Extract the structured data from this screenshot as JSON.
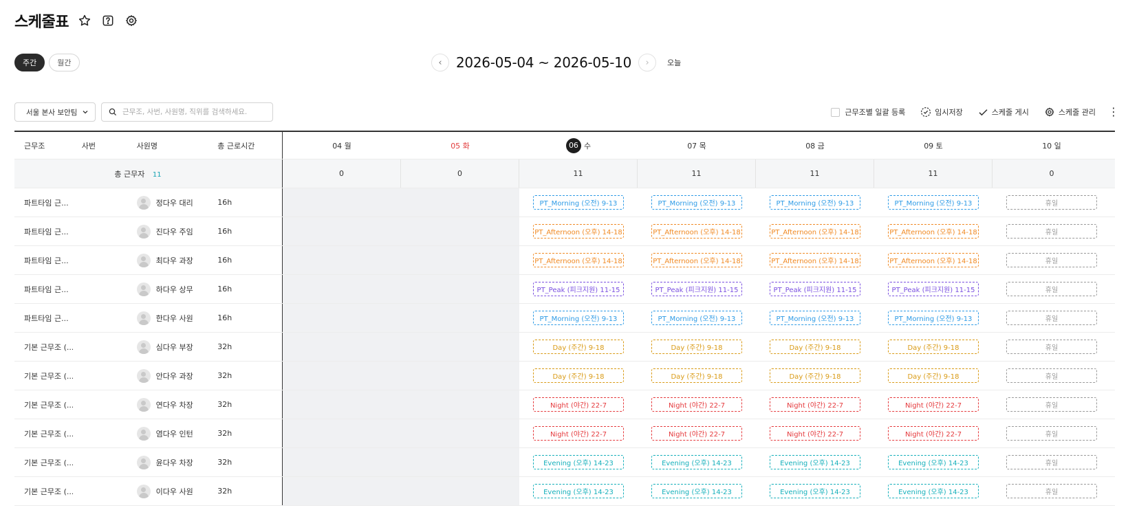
{
  "header": {
    "title": "스케줄표",
    "icons": [
      "star-icon",
      "help-icon",
      "gear-icon"
    ]
  },
  "view_toggle": {
    "weekly": "주간",
    "monthly": "월간",
    "active": "weekly"
  },
  "date_nav": {
    "prev": "‹",
    "range": "2026-05-04 ~ 2026-05-10",
    "next": "›",
    "today": "오늘"
  },
  "toolbar": {
    "team_select": "서울 본사 보안팀",
    "search_placeholder": "근무조, 사번, 사원명, 직위를 검색하세요.",
    "bulk_register": "근무조별 일괄 등록",
    "temp_save": "임시저장",
    "publish": "스케줄 게시",
    "manage": "스케줄 관리"
  },
  "columns": {
    "group": "근무조",
    "emp_no": "사번",
    "name": "사원명",
    "total_hours": "총 근로시간"
  },
  "days": [
    {
      "label": "04 월",
      "num": "",
      "suffix": "",
      "style": "normal",
      "count": "0",
      "bg": "gray"
    },
    {
      "label": "05 화",
      "num": "",
      "suffix": "",
      "style": "red",
      "count": "0",
      "bg": "gray"
    },
    {
      "label": "",
      "num": "06",
      "suffix": "수",
      "style": "today",
      "count": "11",
      "bg": ""
    },
    {
      "label": "07 목",
      "num": "",
      "suffix": "",
      "style": "normal",
      "count": "11",
      "bg": ""
    },
    {
      "label": "08 금",
      "num": "",
      "suffix": "",
      "style": "normal",
      "count": "11",
      "bg": ""
    },
    {
      "label": "09 토",
      "num": "",
      "suffix": "",
      "style": "normal",
      "count": "11",
      "bg": ""
    },
    {
      "label": "10 일",
      "num": "",
      "suffix": "",
      "style": "normal",
      "count": "0",
      "bg": ""
    }
  ],
  "summary": {
    "label": "총 근무자",
    "count": "11"
  },
  "shift_colors": {
    "morning": "#2e9be6",
    "afternoon": "#f08a24",
    "peak": "#7a4fe0",
    "day": "#d99a14",
    "night": "#e5393c",
    "evening": "#16b0bb",
    "off": "#9a9a9a"
  },
  "employees": [
    {
      "group": "파트타임 근...",
      "emp_no": "",
      "name": "정다우 대리",
      "total": "16h",
      "shifts": [
        "",
        "",
        "PT_Morning (오전) 9-13",
        "PT_Morning (오전) 9-13",
        "PT_Morning (오전) 9-13",
        "PT_Morning (오전) 9-13",
        "휴일"
      ],
      "kind": "morning"
    },
    {
      "group": "파트타임 근...",
      "emp_no": "",
      "name": "진다우 주임",
      "total": "16h",
      "shifts": [
        "",
        "",
        "PT_Afternoon (오후) 14-18",
        "PT_Afternoon (오후) 14-18",
        "PT_Afternoon (오후) 14-18",
        "PT_Afternoon (오후) 14-18",
        "휴일"
      ],
      "kind": "afternoon"
    },
    {
      "group": "파트타임 근...",
      "emp_no": "",
      "name": "최다우 과장",
      "total": "16h",
      "shifts": [
        "",
        "",
        "PT_Afternoon (오후) 14-18",
        "PT_Afternoon (오후) 14-18",
        "PT_Afternoon (오후) 14-18",
        "PT_Afternoon (오후) 14-18",
        "휴일"
      ],
      "kind": "afternoon"
    },
    {
      "group": "파트타임 근...",
      "emp_no": "",
      "name": "하다우 상무",
      "total": "16h",
      "shifts": [
        "",
        "",
        "PT_Peak (피크지원) 11-15",
        "PT_Peak (피크지원) 11-15",
        "PT_Peak (피크지원) 11-15",
        "PT_Peak (피크지원) 11-15",
        "휴일"
      ],
      "kind": "peak"
    },
    {
      "group": "파트타임 근...",
      "emp_no": "",
      "name": "한다우 사원",
      "total": "16h",
      "shifts": [
        "",
        "",
        "PT_Morning (오전) 9-13",
        "PT_Morning (오전) 9-13",
        "PT_Morning (오전) 9-13",
        "PT_Morning (오전) 9-13",
        "휴일"
      ],
      "kind": "morning"
    },
    {
      "group": "기본 근무조 (...",
      "emp_no": "",
      "name": "심다우 부장",
      "total": "32h",
      "shifts": [
        "",
        "",
        "Day (주간) 9-18",
        "Day (주간) 9-18",
        "Day (주간) 9-18",
        "Day (주간) 9-18",
        "휴일"
      ],
      "kind": "day"
    },
    {
      "group": "기본 근무조 (...",
      "emp_no": "",
      "name": "안다우 과장",
      "total": "32h",
      "shifts": [
        "",
        "",
        "Day (주간) 9-18",
        "Day (주간) 9-18",
        "Day (주간) 9-18",
        "Day (주간) 9-18",
        "휴일"
      ],
      "kind": "day"
    },
    {
      "group": "기본 근무조 (...",
      "emp_no": "",
      "name": "연다우 차장",
      "total": "32h",
      "shifts": [
        "",
        "",
        "Night (야간) 22-7",
        "Night (야간) 22-7",
        "Night (야간) 22-7",
        "Night (야간) 22-7",
        "휴일"
      ],
      "kind": "night"
    },
    {
      "group": "기본 근무조 (...",
      "emp_no": "",
      "name": "염다우 인턴",
      "total": "32h",
      "shifts": [
        "",
        "",
        "Night (야간) 22-7",
        "Night (야간) 22-7",
        "Night (야간) 22-7",
        "Night (야간) 22-7",
        "휴일"
      ],
      "kind": "night"
    },
    {
      "group": "기본 근무조 (...",
      "emp_no": "",
      "name": "윤다우 차장",
      "total": "32h",
      "shifts": [
        "",
        "",
        "Evening (오후) 14-23",
        "Evening (오후) 14-23",
        "Evening (오후) 14-23",
        "Evening (오후) 14-23",
        "휴일"
      ],
      "kind": "evening"
    },
    {
      "group": "기본 근무조 (...",
      "emp_no": "",
      "name": "이다우 사원",
      "total": "32h",
      "shifts": [
        "",
        "",
        "Evening (오후) 14-23",
        "Evening (오후) 14-23",
        "Evening (오후) 14-23",
        "Evening (오후) 14-23",
        "휴일"
      ],
      "kind": "evening"
    }
  ]
}
